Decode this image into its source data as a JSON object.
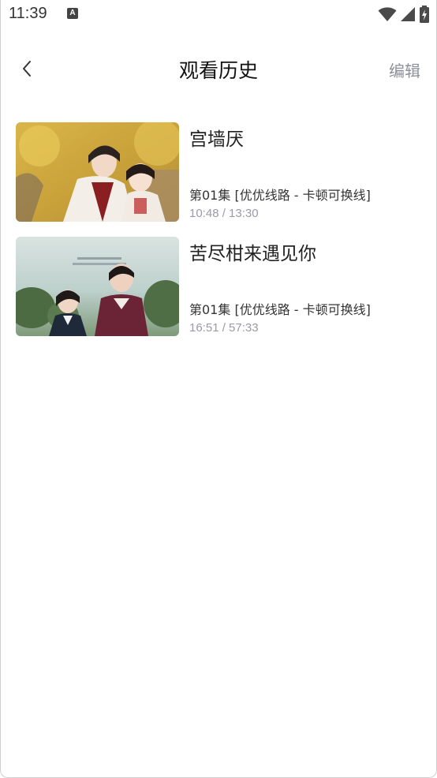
{
  "status_bar": {
    "time": "11:39",
    "notification_icon": "a-notification-icon",
    "wifi_icon": "wifi-icon",
    "signal_icon": "signal-icon",
    "battery_icon": "battery-charging-icon"
  },
  "header": {
    "back_icon": "chevron-left-icon",
    "title": "观看历史",
    "edit_label": "编辑"
  },
  "history": [
    {
      "title": "宫墙厌",
      "episode": "第01集 [优优线路 - 卡顿可换线]",
      "progress": "10:48 / 13:30"
    },
    {
      "title": "苦尽柑来遇见你",
      "episode": "第01集 [优优线路 - 卡顿可换线]",
      "progress": "16:51 / 57:33"
    }
  ]
}
